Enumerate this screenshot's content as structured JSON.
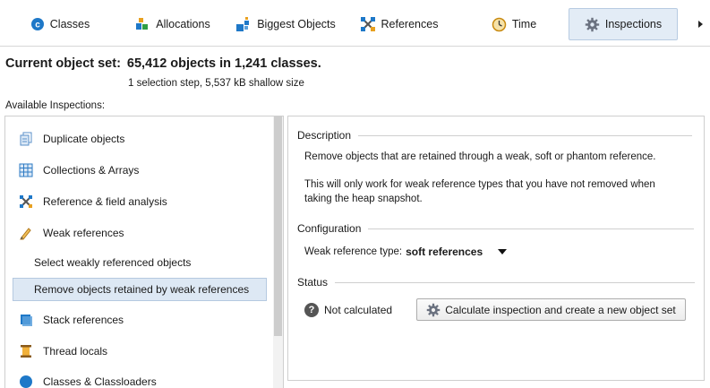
{
  "tabs": [
    {
      "label": "Classes",
      "icon": "class-c-icon"
    },
    {
      "label": "Allocations",
      "icon": "allocation-stack-icon"
    },
    {
      "label": "Biggest Objects",
      "icon": "biggest-objects-icon"
    },
    {
      "label": "References",
      "icon": "references-icon"
    },
    {
      "label": "Time",
      "icon": "clock-icon"
    },
    {
      "label": "Inspections",
      "icon": "gear-icon",
      "active": true
    }
  ],
  "header": {
    "title_label": "Current object set:",
    "title_value": "65,412 objects in 1,241 classes.",
    "subtitle": "1 selection step, 5,537 kB shallow size",
    "available_label": "Available Inspections:"
  },
  "inspections": [
    {
      "label": "Duplicate objects",
      "icon": "duplicate-objects-icon"
    },
    {
      "label": "Collections & Arrays",
      "icon": "grid-table-icon"
    },
    {
      "label": "Reference & field analysis",
      "icon": "reference-field-icon"
    },
    {
      "label": "Weak references",
      "icon": "pencil-icon"
    },
    {
      "label": "Select weakly referenced objects"
    },
    {
      "label": "Remove objects retained by weak references",
      "selected": true
    },
    {
      "label": "Stack references",
      "icon": "stack-icon"
    },
    {
      "label": "Thread locals",
      "icon": "thread-icon"
    },
    {
      "label": "Classes & Classloaders",
      "icon": "classloader-icon"
    }
  ],
  "details": {
    "description_heading": "Description",
    "description_line1": "Remove objects that are retained through a weak, soft or phantom reference.",
    "description_line2a": "This will only work for weak reference types that you have not removed when",
    "description_line2b": "taking the heap snapshot.",
    "configuration_heading": "Configuration",
    "config_label": "Weak reference type:",
    "config_value": "soft references",
    "status_heading": "Status",
    "status_text": "Not calculated",
    "calculate_button": "Calculate inspection and create a new object set"
  },
  "colors": {
    "active_tab_bg": "#e3ecf6",
    "selected_item_bg": "#dde8f4",
    "accent_blue": "#1e78c8"
  }
}
